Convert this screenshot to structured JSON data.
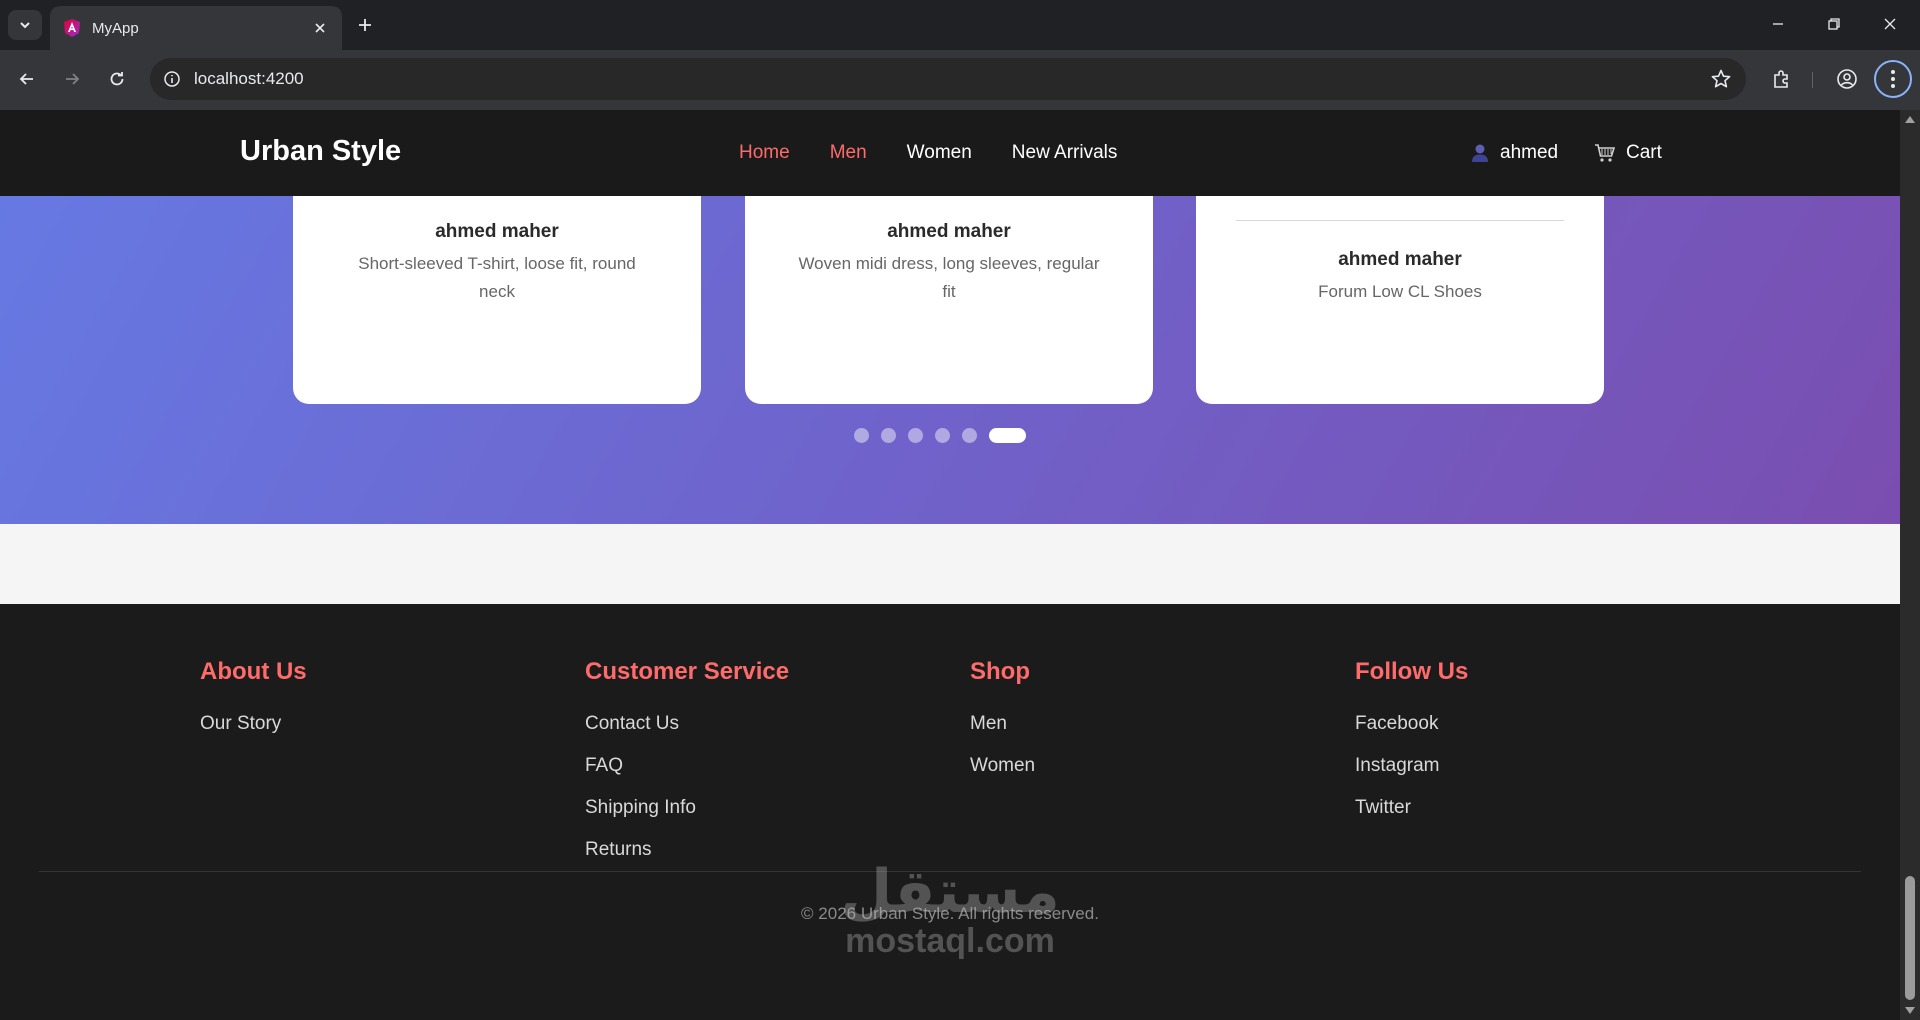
{
  "browser": {
    "tab_title": "MyApp",
    "url": "localhost:4200"
  },
  "site": {
    "brand": "Urban Style",
    "nav": [
      {
        "label": "Home"
      },
      {
        "label": "Men"
      },
      {
        "label": "Women"
      },
      {
        "label": "New Arrivals"
      }
    ],
    "user_name": "ahmed",
    "cart_label": "Cart"
  },
  "carousel": {
    "cards": [
      {
        "name": "ahmed maher",
        "description": "Short-sleeved T-shirt, loose fit, round neck"
      },
      {
        "name": "ahmed maher",
        "description": "Woven midi dress, long sleeves, regular fit"
      },
      {
        "name": "ahmed maher",
        "description": "Forum Low CL Shoes"
      }
    ],
    "dot_count": 6,
    "active_dot": 6
  },
  "footer": {
    "columns": [
      {
        "heading": "About Us",
        "links": [
          "Our Story"
        ]
      },
      {
        "heading": "Customer Service",
        "links": [
          "Contact Us",
          "FAQ",
          "Shipping Info",
          "Returns"
        ]
      },
      {
        "heading": "Shop",
        "links": [
          "Men",
          "Women"
        ]
      },
      {
        "heading": "Follow Us",
        "links": [
          "Facebook",
          "Instagram",
          "Twitter"
        ]
      }
    ],
    "copyright": "© 2026 Urban Style. All rights reserved."
  },
  "watermark": {
    "arabic": "مستقل",
    "latin": "mostaql.com"
  },
  "colors": {
    "accent": "#ff6b6b",
    "hero_start": "#667ae4",
    "hero_end": "#7a4eb0",
    "header_bg": "#1a1a1a"
  }
}
